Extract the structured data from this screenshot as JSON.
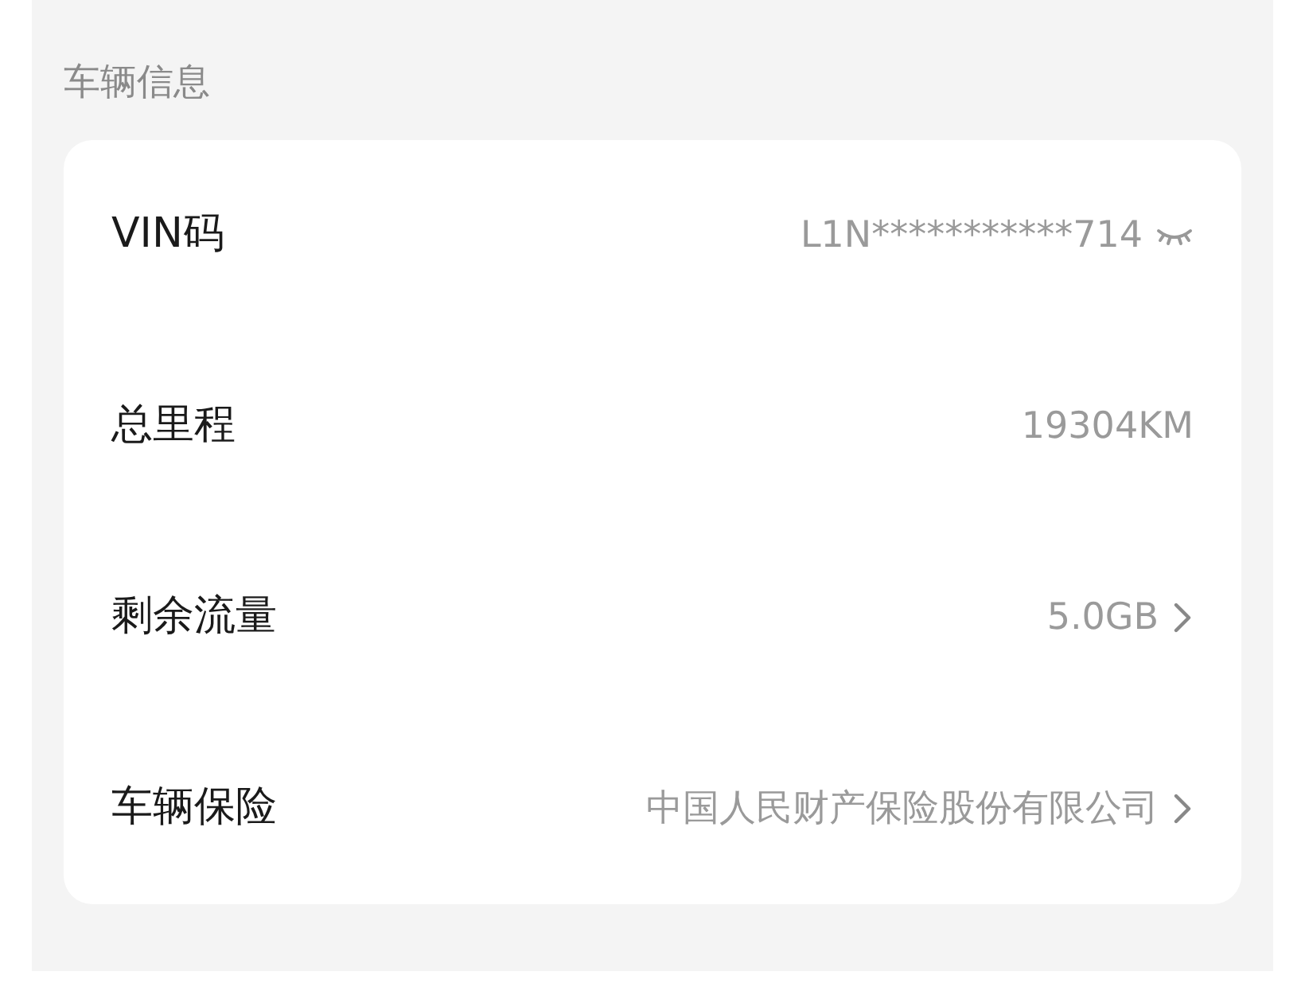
{
  "section": {
    "title": "车辆信息"
  },
  "rows": [
    {
      "label": "VIN码",
      "value": "L1N***********714",
      "kind": "masked"
    },
    {
      "label": "总里程",
      "value": "19304KM",
      "kind": "plain"
    },
    {
      "label": "剩余流量",
      "value": "5.0GB",
      "kind": "link"
    },
    {
      "label": "车辆保险",
      "value": "中国人民财产保险股份有限公司",
      "kind": "link"
    }
  ]
}
